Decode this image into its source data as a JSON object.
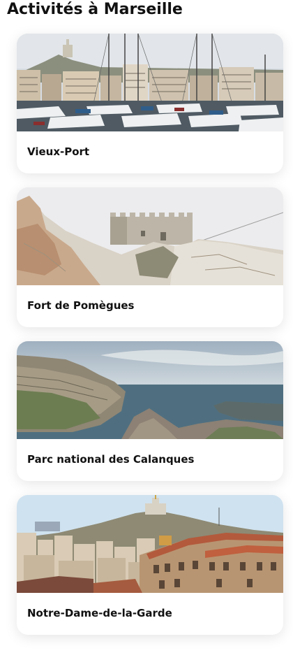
{
  "page": {
    "title": "Activités à Marseille"
  },
  "activities": [
    {
      "name": "Vieux-Port",
      "image": "harbor-photo"
    },
    {
      "name": "Fort de Pomègues",
      "image": "fort-photo"
    },
    {
      "name": "Parc national des Calanques",
      "image": "calanques-photo"
    },
    {
      "name": "Notre-Dame-de-la-Garde",
      "image": "city-photo"
    }
  ]
}
